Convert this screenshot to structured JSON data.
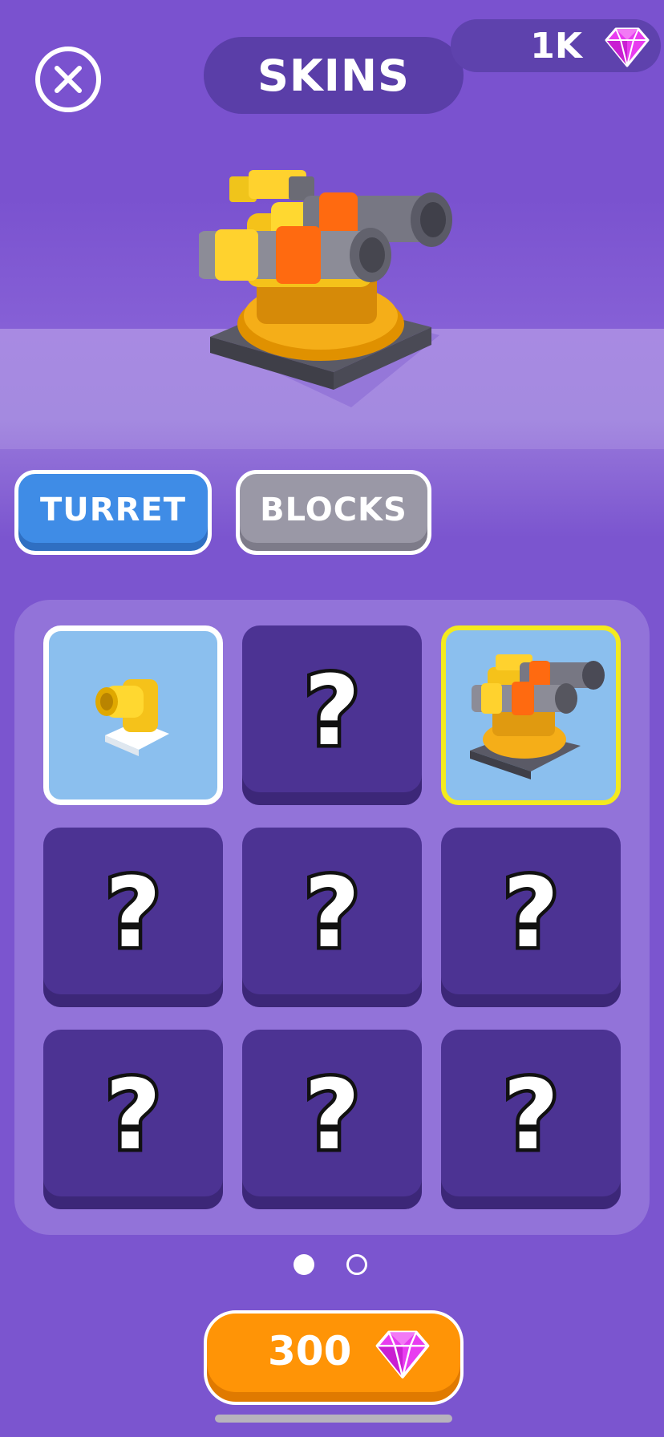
{
  "header": {
    "title": "SKINS",
    "close_icon": "close-icon",
    "currency": {
      "value": "1K",
      "icon": "gem-icon",
      "color": "#e83cf0"
    }
  },
  "tabs": [
    {
      "label": "TURRET",
      "active": true,
      "color": "#3f8ce6"
    },
    {
      "label": "BLOCKS",
      "active": false,
      "color": "#9a98a6"
    }
  ],
  "grid": {
    "cells": [
      {
        "state": "unlocked",
        "icon": "small-yellow-turret-icon",
        "highlight": "white"
      },
      {
        "state": "locked",
        "icon": "question-mark-icon"
      },
      {
        "state": "unlocked",
        "icon": "twin-cannon-turret-icon",
        "highlight": "yellow"
      },
      {
        "state": "locked",
        "icon": "question-mark-icon"
      },
      {
        "state": "locked",
        "icon": "question-mark-icon"
      },
      {
        "state": "locked",
        "icon": "question-mark-icon"
      },
      {
        "state": "locked",
        "icon": "question-mark-icon"
      },
      {
        "state": "locked",
        "icon": "question-mark-icon"
      },
      {
        "state": "locked",
        "icon": "question-mark-icon"
      }
    ]
  },
  "pagination": {
    "current_page": 1,
    "total_pages": 2
  },
  "buy_button": {
    "price": "300",
    "icon": "gem-icon",
    "color": "#ff9406"
  },
  "colors": {
    "background": "#7b55cf",
    "panel": "#9273d9",
    "locked_cell": "#4c3393",
    "unlocked_cell": "#8bbfee"
  }
}
